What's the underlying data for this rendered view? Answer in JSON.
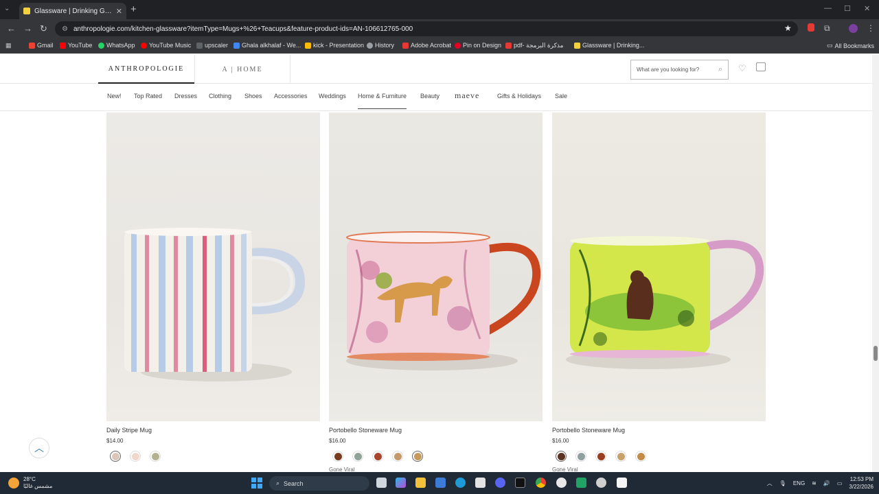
{
  "browser": {
    "tab_title": "Glassware | Drinking Glasses &",
    "tab_close": "✕",
    "tab_menu": "⌄",
    "newtab_label": "+",
    "url": "anthropologie.com/kitchen-glassware?itemType=Mugs+%26+Teacups&feature-product-ids=AN-106612765-000",
    "back": "←",
    "forward": "→",
    "reload": "↻",
    "star": "★",
    "win_min": "—",
    "win_max": "☐",
    "win_close": "✕",
    "bookmarks": [
      {
        "label": "Gmail",
        "color": "#ea4335"
      },
      {
        "label": "YouTube",
        "color": "#ff0000"
      },
      {
        "label": "WhatsApp",
        "color": "#25d366"
      },
      {
        "label": "YouTube Music",
        "color": "#ff0000"
      },
      {
        "label": "upscaler",
        "color": "#5f6368"
      },
      {
        "label": "Ghala alkhalaf - We...",
        "color": "#4285f4"
      },
      {
        "label": "kick - Presentation",
        "color": "#ffba00"
      },
      {
        "label": "History",
        "color": "#9aa0a6"
      },
      {
        "label": "Adobe Acrobat",
        "color": "#e53935"
      },
      {
        "label": "Pin on Design",
        "color": "#e60023"
      },
      {
        "label": "pdf- مذكرة البرمجة",
        "color": "#e53935"
      },
      {
        "label": "Glassware | Drinking...",
        "color": "#f4d03f"
      }
    ],
    "all_bookmarks": "All Bookmarks"
  },
  "header": {
    "logo": "ANTHROPOLOGIE",
    "home_link": "A | HOME",
    "search_placeholder": "What are you looking for?",
    "search_icon": "⌕",
    "wishlist_icon": "♡",
    "bag_icon": "🛍"
  },
  "nav": [
    {
      "label": "New!"
    },
    {
      "label": "Top Rated"
    },
    {
      "label": "Dresses"
    },
    {
      "label": "Clothing"
    },
    {
      "label": "Shoes"
    },
    {
      "label": "Accessories"
    },
    {
      "label": "Weddings"
    },
    {
      "label": "Home & Furniture"
    },
    {
      "label": "Beauty"
    },
    {
      "label": "maeve"
    },
    {
      "label": "Gifts & Holidays"
    },
    {
      "label": "Sale"
    }
  ],
  "products": [
    {
      "name": "Daily Stripe Mug",
      "price": "$14.00",
      "badge": "",
      "swatches": [
        "#d9c6b8",
        "#f1d8cc",
        "#b3b392"
      ]
    },
    {
      "name": "Portobello Stoneware Mug",
      "price": "$16.00",
      "badge": "Gone Viral",
      "swatches": [
        "#7a3a1e",
        "#8fa398",
        "#a8452a",
        "#c49a6c",
        "#c79a5a"
      ]
    },
    {
      "name": "Portobello Stoneware Mug",
      "price": "$16.00",
      "badge": "Gone Viral",
      "swatches": [
        "#5b3324",
        "#8fa0a0",
        "#9a3e22",
        "#c7a26a",
        "#c48a4a"
      ]
    }
  ],
  "back_to_top": "︿",
  "taskbar": {
    "temp": "28°C",
    "weather_desc": "مشمس غالبًا",
    "search_label": "Search",
    "lang": "ENG",
    "time": "12:53 PM",
    "date": "3/22/2026"
  }
}
